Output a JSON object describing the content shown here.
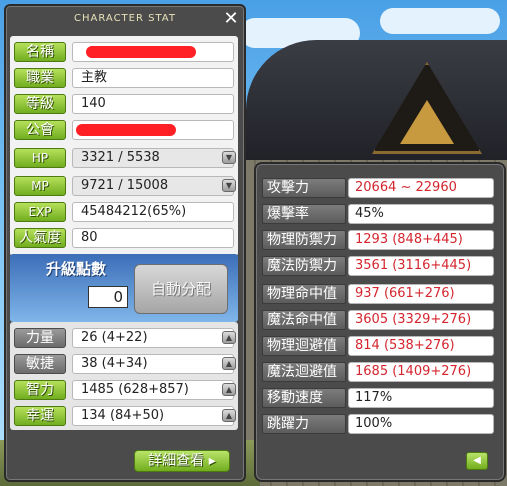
{
  "window": {
    "title": "CHARACTER STAT",
    "close_icon": "close-icon"
  },
  "info": [
    {
      "label": "名稱",
      "value": "",
      "redacted": true
    },
    {
      "label": "職業",
      "value": "主教"
    },
    {
      "label": "等級",
      "value": "140"
    },
    {
      "label": "公會",
      "value": "",
      "redacted": true
    },
    {
      "label": "HP",
      "value": "3321 / 5538",
      "has_arrow": true
    },
    {
      "label": "MP",
      "value": "9721 / 15008",
      "has_arrow": true
    },
    {
      "label": "EXP",
      "value": "45484212(65%)"
    },
    {
      "label": "人氣度",
      "value": "80"
    }
  ],
  "ability_points": {
    "title": "升級點數",
    "value": "0",
    "auto_assign_label": "自動分配"
  },
  "stats": [
    {
      "label": "力量",
      "value": "26 (4+22)"
    },
    {
      "label": "敏捷",
      "value": "38 (4+34)"
    },
    {
      "label": "智力",
      "value": "1485 (628+857)"
    },
    {
      "label": "幸運",
      "value": "134 (84+50)"
    }
  ],
  "detail_button_label": "詳細查看",
  "detail": [
    {
      "label": "攻擊力",
      "value": "20664 ~ 22960",
      "color": "red"
    },
    {
      "label": "爆擊率",
      "value": "45%",
      "color": "dark"
    },
    {
      "label": "物理防禦力",
      "value": "1293 (848+445)",
      "color": "red"
    },
    {
      "label": "魔法防禦力",
      "value": "3561 (3116+445)",
      "color": "red"
    },
    {
      "label": "物理命中值",
      "value": "937 (661+276)",
      "color": "red"
    },
    {
      "label": "魔法命中值",
      "value": "3605 (3329+276)",
      "color": "red"
    },
    {
      "label": "物理迴避值",
      "value": "814 (538+276)",
      "color": "red"
    },
    {
      "label": "魔法迴避值",
      "value": "1685 (1409+276)",
      "color": "red"
    },
    {
      "label": "移動速度",
      "value": "117%",
      "color": "dark"
    },
    {
      "label": "跳躍力",
      "value": "100%",
      "color": "dark"
    }
  ],
  "colors": {
    "label_green": "#71ad1f",
    "value_red": "#d4262f",
    "panel_dark": "#4b4b4b",
    "ap_blue": "#3c6eb8"
  }
}
